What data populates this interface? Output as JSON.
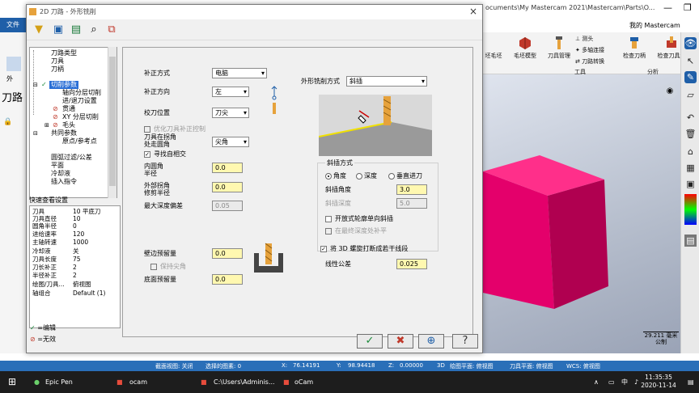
{
  "background": {
    "title_path": "ocuments\\My Mastercam 2021\\Mastercam\\Parts\\O...",
    "file_menu": "文件",
    "left_label": "外",
    "toolpath_label": "刀路",
    "my_mastercam": "我的 Mastercam",
    "ribbon": {
      "items": [
        "毛坯模型",
        "刀具管理",
        "测头",
        "多轴连接",
        "刀路转换",
        "检查刀柄",
        "检查刀具触"
      ],
      "partial_left": "坯毛坯",
      "groups": [
        "工具",
        "分析"
      ]
    },
    "scale_value": "29.211 毫米",
    "scale_unit": "公制"
  },
  "statusbar": {
    "section_view": "截面视图: 关闭",
    "selected": "选择的图素: 0",
    "x_label": "X:",
    "x_value": "76.14191",
    "y_label": "Y:",
    "y_value": "98.94418",
    "z_label": "Z:",
    "z_value": "0.00000",
    "mode": "3D",
    "draw_plane": "绘图平面: 俯视图",
    "tool_plane": "刀具平面: 俯视图",
    "wcs": "WCS: 俯视图"
  },
  "taskbar": {
    "items": [
      "Epic Pen",
      "ocam",
      "C:\\Users\\Adminis...",
      "oCam"
    ],
    "tray_lang": "中",
    "time": "11:35:35",
    "date": "2020-11-14"
  },
  "dialog": {
    "title": "2D 刀路 - 外形铣削",
    "close": "×",
    "tree": {
      "items": [
        "刀路类型",
        "刀具",
        "刀柄",
        "切削参数",
        "轴向分层切削",
        "进/退刀设置",
        "贯通",
        "XY 分层切削",
        "毛头",
        "共同参数",
        "原点/参考点",
        "圆弧过滤/公差",
        "平面",
        "冷却液",
        "插入指令"
      ]
    },
    "quick_view": {
      "title": "快速查看设置",
      "rows": [
        {
          "k": "刀具",
          "v": "10 平底刀"
        },
        {
          "k": "刀具直径",
          "v": "10"
        },
        {
          "k": "圆角半径",
          "v": "0"
        },
        {
          "k": "进给速率",
          "v": "120"
        },
        {
          "k": "主轴转速",
          "v": "1000"
        },
        {
          "k": "冷却液",
          "v": "关"
        },
        {
          "k": "刀具长度",
          "v": "75"
        },
        {
          "k": "刀长补正",
          "v": "2"
        },
        {
          "k": "半径补正",
          "v": "2"
        },
        {
          "k": "绘图/刀具...",
          "v": "俯视图"
        },
        {
          "k": "轴组合",
          "v": "Default (1)"
        }
      ]
    },
    "legend": {
      "edited": "=编辑",
      "invalid": "=无效"
    },
    "panel": {
      "comp_type_label": "补正方式",
      "comp_type_value": "电脑",
      "comp_dir_label": "补正方向",
      "comp_dir_value": "左",
      "tip_comp_label": "校刀位置",
      "tip_comp_value": "刀尖",
      "optimize_label": "优化刀具补正控制",
      "corner_label_1": "刀具在拐角",
      "corner_label_2": "处走圆角",
      "corner_value": "尖角",
      "find_self_label": "寻找自相交",
      "inner_radius_label_1": "内圆角",
      "inner_radius_label_2": "半径",
      "inner_radius_value": "0.0",
      "outer_radius_label_1": "外部拐角",
      "outer_radius_label_2": "修剪半径",
      "outer_radius_value": "0.0",
      "max_depth_label": "最大深度偏差",
      "max_depth_value": "0.05",
      "wall_stock_label": "壁边预留量",
      "wall_stock_value": "0.0",
      "keep_sharp_label": "保持尖角",
      "floor_stock_label": "底面预留量",
      "floor_stock_value": "0.0",
      "contour_type_label": "外形铣削方式",
      "contour_type_value": "斜插",
      "ramp_group_label": "斜插方式",
      "ramp_angle_radio": "角度",
      "ramp_depth_radio": "深度",
      "ramp_vertical_radio": "垂直进刀",
      "ramp_angle_label": "斜插角度",
      "ramp_angle_value": "3.0",
      "ramp_depth_label": "斜插深度",
      "ramp_depth_value": "5.0",
      "open_contour_label": "开放式轮廓单向斜插",
      "final_depth_label": "在最终深度处补平",
      "break_helix_label": "将 3D 螺旋打断成若干线段",
      "linear_tol_label": "线性公差",
      "linear_tol_value": "0.025"
    }
  }
}
